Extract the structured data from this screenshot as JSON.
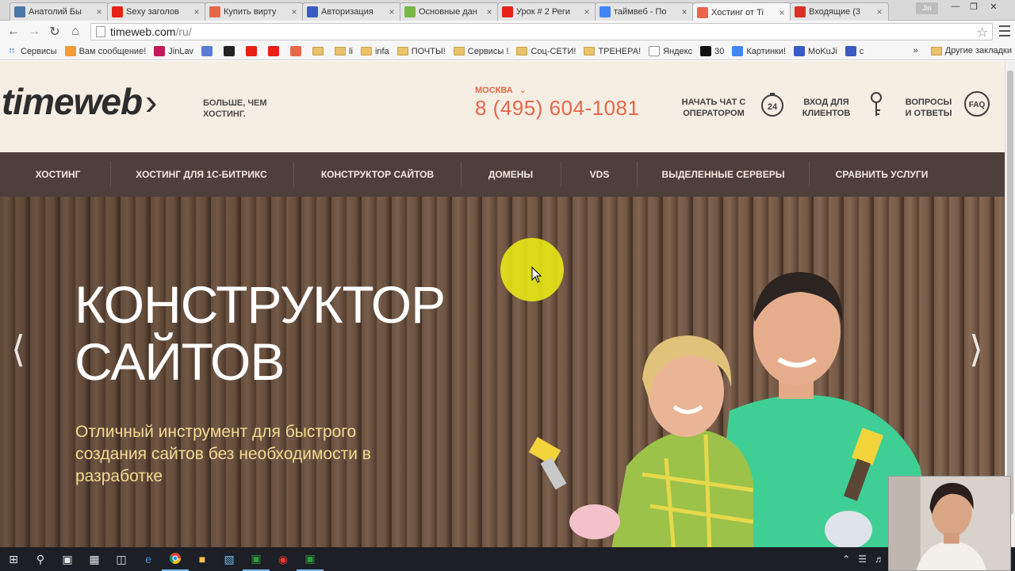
{
  "browser": {
    "tabs": [
      {
        "title": "Анатолий Бы",
        "favicon_color": "#4a76a8",
        "favicon_glyph": "vk-icon"
      },
      {
        "title": "Sexy заголов",
        "favicon_color": "#e62117",
        "favicon_glyph": "youtube-icon"
      },
      {
        "title": "Купить вирту",
        "favicon_color": "#e8674a",
        "favicon_glyph": "timeweb-icon"
      },
      {
        "title": "Авторизация",
        "favicon_color": "#3b5bc4",
        "favicon_glyph": "chevron-icon"
      },
      {
        "title": "Основные дан",
        "favicon_color": "#7ab648",
        "favicon_glyph": "g-icon"
      },
      {
        "title": "Урок # 2 Реги",
        "favicon_color": "#e62117",
        "favicon_glyph": "youtube-icon"
      },
      {
        "title": "таймвеб - По",
        "favicon_color": "#4285f4",
        "favicon_glyph": "google-icon"
      },
      {
        "title": "Хостинг от Ti",
        "favicon_color": "#e8674a",
        "favicon_glyph": "timeweb-icon",
        "active": true
      },
      {
        "title": "Входящие (3",
        "favicon_color": "#d93025",
        "favicon_glyph": "gmail-icon"
      }
    ],
    "user_badge": "Jin",
    "url_host": "timeweb.com",
    "url_path": "/ru/",
    "bookmarks": [
      {
        "label": "Сервисы",
        "type": "apps"
      },
      {
        "label": "Вам сообщение!",
        "type": "site",
        "color": "#f29b38"
      },
      {
        "label": "JinLav",
        "type": "site",
        "color": "#c2185b"
      },
      {
        "label": "",
        "type": "site",
        "color": "#5b7bd5"
      },
      {
        "label": "",
        "type": "site",
        "color": "#222222"
      },
      {
        "label": "",
        "type": "site",
        "color": "#e62117"
      },
      {
        "label": "",
        "type": "site",
        "color": "#e62117"
      },
      {
        "label": "",
        "type": "site",
        "color": "#e8674a"
      },
      {
        "label": "",
        "type": "folder"
      },
      {
        "label": "li",
        "type": "folder"
      },
      {
        "label": "infa",
        "type": "folder"
      },
      {
        "label": "ПОЧТЫ!",
        "type": "folder"
      },
      {
        "label": "Сервисы !",
        "type": "folder"
      },
      {
        "label": "Соц-СЕТИ!",
        "type": "folder"
      },
      {
        "label": "ТРЕНЕРА!",
        "type": "folder"
      },
      {
        "label": "Яндекс",
        "type": "page"
      },
      {
        "label": "30",
        "type": "site",
        "color": "#111111"
      },
      {
        "label": "Картинки!",
        "type": "site",
        "color": "#4285f4"
      },
      {
        "label": "MoKuJi",
        "type": "site",
        "color": "#3b5bc4"
      },
      {
        "label": "c",
        "type": "site",
        "color": "#3b5bc4"
      }
    ],
    "bookmarks_overflow": "»",
    "bookmarks_other": "Другие закладки"
  },
  "site": {
    "logo": "timeweb",
    "tagline": "БОЛЬШЕ, ЧЕМ ХОСТИНГ.",
    "city": "МОСКВА",
    "phone": "8 (495) 604-1081",
    "header_links": [
      {
        "label": "НАЧАТЬ ЧАТ С ОПЕРАТОРОМ",
        "icon": "timer-24-icon"
      },
      {
        "label": "ВХОД ДЛЯ КЛИЕНТОВ",
        "icon": "key-icon"
      },
      {
        "label": "ВОПРОСЫ И ОТВЕТЫ",
        "icon": "faq-icon"
      }
    ],
    "faq_icon_text": "FAQ",
    "timer_icon_text": "24",
    "nav": [
      "ХОСТИНГ",
      "ХОСТИНГ ДЛЯ 1С-БИТРИКС",
      "КОНСТРУКТОР САЙТОВ",
      "ДОМЕНЫ",
      "VDS",
      "ВЫДЕЛЕННЫЕ СЕРВЕРЫ",
      "СРАВНИТЬ УСЛУГИ"
    ],
    "hero": {
      "title_line1": "КОНСТРУКТОР",
      "title_line2": "САЙТОВ",
      "subtitle": "Отличный инструмент для быстрого создания сайтов без необходимости в разработке"
    }
  },
  "colors": {
    "accent": "#e8674a",
    "nav_bg": "#4e3f3a",
    "hero_subtitle": "#f2dc93"
  }
}
